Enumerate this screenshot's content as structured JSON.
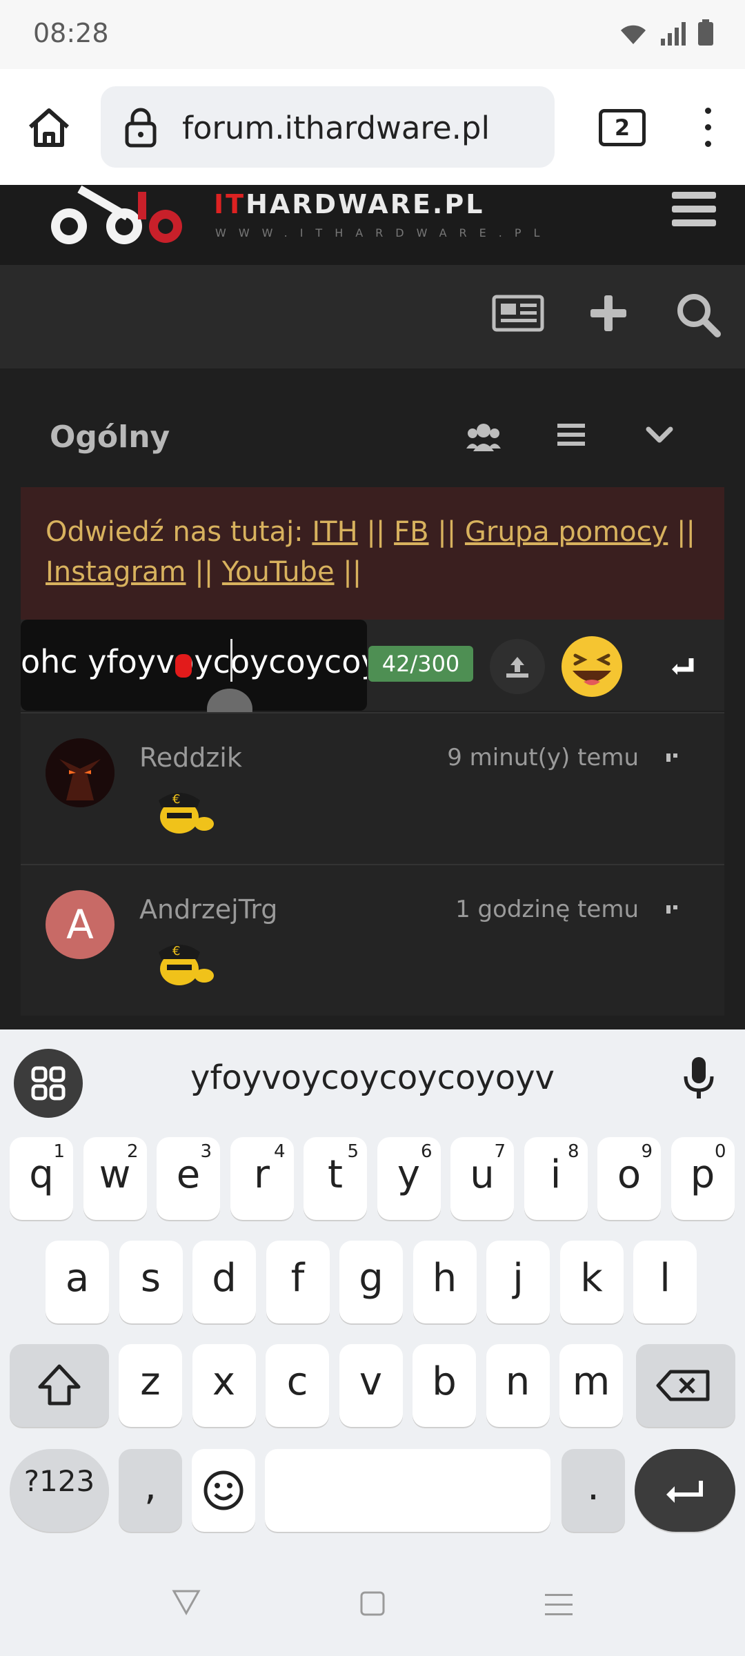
{
  "status_bar": {
    "time": "08:28"
  },
  "browser": {
    "url": "forum.ithardware.pl",
    "tab_count": "2"
  },
  "site": {
    "logo_text_it": "IT",
    "logo_text_rest": "HARDWARE.PL",
    "logo_sub": "WWW.ITHARDWARE.PL"
  },
  "channel": {
    "title": "Ogólny"
  },
  "banner": {
    "prefix": "Odwiedź nas tutaj: ",
    "links": [
      "ITH",
      "FB",
      "Grupa pomocy",
      "Instagram",
      "YouTube"
    ],
    "separator": " || "
  },
  "composer": {
    "value": "ohc yfoyvoycoycoycoycoy",
    "counter": "42/300"
  },
  "messages": [
    {
      "user": "Reddzik",
      "time": "9 minut(y) temu",
      "avatar_color": "#2a0f0f"
    },
    {
      "user": "AndrzejTrg",
      "time": "1 godzinę temu",
      "avatar_letter": "A",
      "avatar_color": "#c86a66"
    }
  ],
  "keyboard": {
    "suggestion": "yfoyvoycoycoycoyoyv",
    "row1": [
      "q",
      "w",
      "e",
      "r",
      "t",
      "y",
      "u",
      "i",
      "o",
      "p"
    ],
    "row1_hints": [
      "1",
      "2",
      "3",
      "4",
      "5",
      "6",
      "7",
      "8",
      "9",
      "0"
    ],
    "row2": [
      "a",
      "s",
      "d",
      "f",
      "g",
      "h",
      "j",
      "k",
      "l"
    ],
    "row3": [
      "z",
      "x",
      "c",
      "v",
      "b",
      "n",
      "m"
    ],
    "symbols": "?123",
    "comma": ",",
    "period": "."
  }
}
